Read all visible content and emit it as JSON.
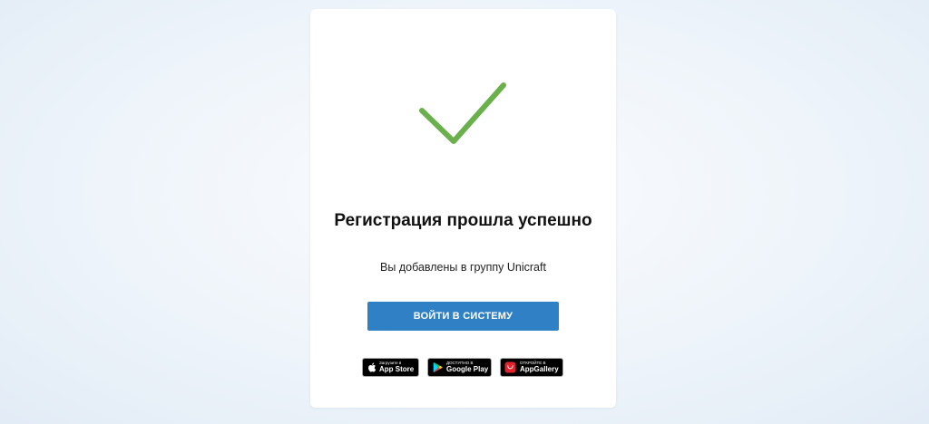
{
  "card": {
    "title": "Регистрация прошла успешно",
    "subtitle": "Вы добавлены в группу Unicraft",
    "login_button": "ВОЙТИ В СИСТЕМУ"
  },
  "stores": {
    "apple": {
      "small": "Загрузите в",
      "big": "App Store",
      "icon": "apple-icon"
    },
    "google": {
      "small": "ДОСТУПНО В",
      "big": "Google Play",
      "icon": "google-play-icon"
    },
    "huawei": {
      "small": "ОТКРОЙТЕ В",
      "big": "AppGallery",
      "icon": "huawei-icon"
    }
  },
  "colors": {
    "accent": "#2f80c4",
    "success": "#6ab04c",
    "badge_bg": "#000000",
    "huawei_red": "#e3222d"
  },
  "icons": {
    "success": "checkmark-icon"
  }
}
